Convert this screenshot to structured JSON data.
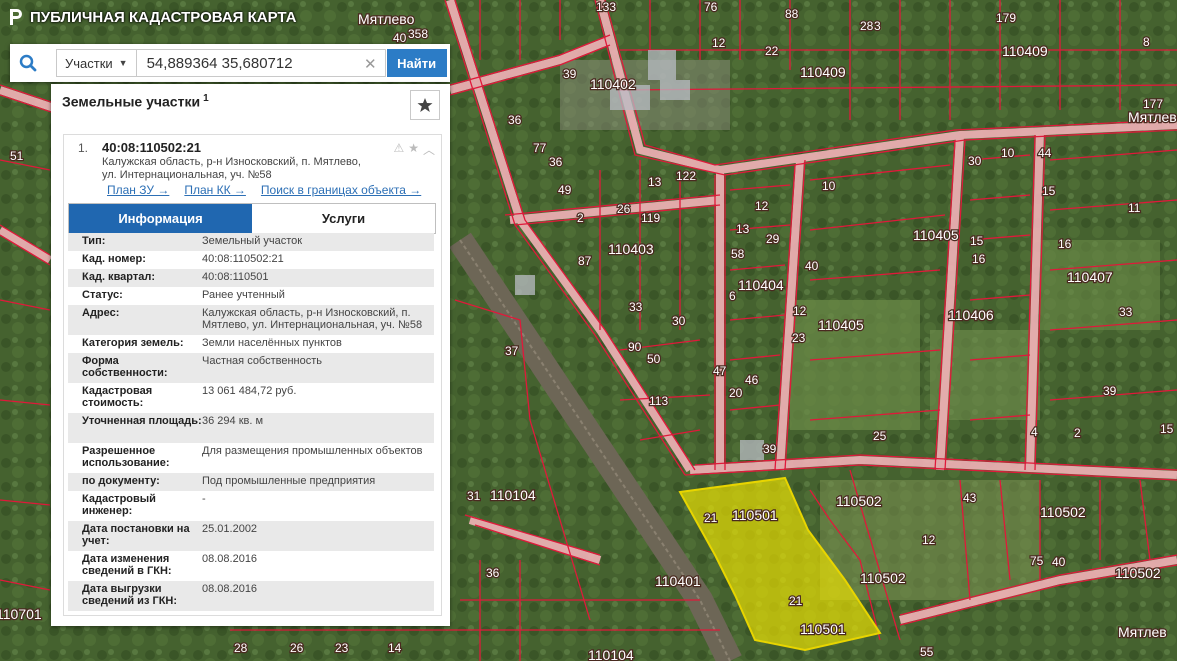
{
  "header": {
    "title": "ПУБЛИЧНАЯ КАДАСТРОВАЯ КАРТА"
  },
  "search": {
    "type_label": "Участки",
    "query": "54,889364 35,680712",
    "find_label": "Найти"
  },
  "panel": {
    "title": "Земельные участки",
    "count": "1"
  },
  "result": {
    "num": "1.",
    "cad_id": "40:08:110502:21",
    "address_line1": "Калужская область, р-н Износковский, п. Мятлево,",
    "address_line2": "ул. Интернациональная, уч. №58",
    "links": [
      "План ЗУ →",
      "План КК →",
      "Поиск в границах объекта →"
    ],
    "tabs": {
      "info": "Информация",
      "services": "Услуги"
    },
    "properties": [
      {
        "k": "Тип:",
        "v": "Земельный участок"
      },
      {
        "k": "Кад. номер:",
        "v": "40:08:110502:21"
      },
      {
        "k": "Кад. квартал:",
        "v": "40:08:110501"
      },
      {
        "k": "Статус:",
        "v": "Ранее учтенный"
      },
      {
        "k": "Адрес:",
        "v": "Калужская область, р-н Износковский, п. Мятлево, ул. Интернациональная, уч. №58"
      },
      {
        "k": "Категория земель:",
        "v": "Земли населённых пунктов"
      },
      {
        "k": "Форма собственности:",
        "v": "Частная собственность"
      },
      {
        "k": "Кадастровая стоимость:",
        "v": "13 061 484,72 руб."
      },
      {
        "k": "Уточненная площадь:",
        "v": "36 294 кв. м"
      },
      {
        "k": "Разрешенное использование:",
        "v": "Для размещения промышленных объектов"
      },
      {
        "k": "по документу:",
        "v": "Под промышленные предприятия"
      },
      {
        "k": "Кадастровый инженер:",
        "v": "-"
      },
      {
        "k": "Дата постановки на учет:",
        "v": "25.01.2002"
      },
      {
        "k": "Дата изменения сведений в ГКН:",
        "v": "08.08.2016"
      },
      {
        "k": "Дата выгрузки сведений из ГКН:",
        "v": "08.08.2016"
      }
    ]
  },
  "map": {
    "labels": [
      "Мятлево",
      "358",
      "40",
      "133",
      "76",
      "88",
      "28",
      "3",
      "179",
      "8",
      "110409",
      "110402",
      "110409",
      "22",
      "12",
      "39",
      "177",
      "Мятлево",
      "51",
      "36",
      "77",
      "36",
      "49",
      "2",
      "119",
      "110403",
      "26",
      "122",
      "13",
      "10",
      "30",
      "10",
      "44",
      "15",
      "11",
      "110405",
      "13",
      "29",
      "12",
      "58",
      "16",
      "15",
      "16",
      "110407",
      "110404",
      "6",
      "40",
      "110405",
      "110406",
      "33",
      "37",
      "87",
      "33",
      "30",
      "90",
      "50",
      "12",
      "23",
      "47",
      "113",
      "20",
      "46",
      "25",
      "39",
      "4",
      "2",
      "39",
      "43",
      "31",
      "110104",
      "110501",
      "21",
      "110502",
      "110502",
      "21",
      "110501",
      "110401",
      "110502",
      "110502",
      "36",
      "75",
      "40",
      "12",
      "15",
      "110701",
      "28",
      "26",
      "23",
      "14",
      "110104",
      "55",
      "Мятлев"
    ],
    "parcel_color": "#f2e600",
    "boundary_color": "#e0193a"
  }
}
